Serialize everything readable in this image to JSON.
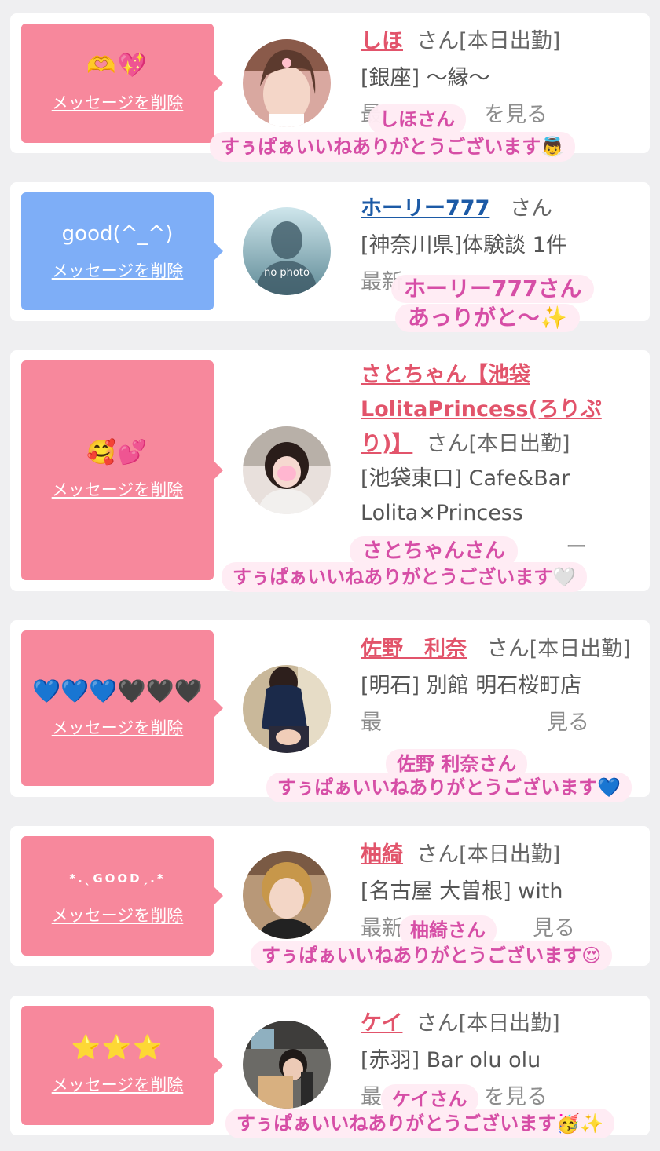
{
  "delete_label": "メッセージを削除",
  "entries": [
    {
      "message": "🫶💖",
      "name": "しほ",
      "san": "さん",
      "status": "[本日出勤]",
      "location": "[銀座] 〜縁〜",
      "caption_name": "しほさん",
      "caption_text": "すぅぱぁいいねありがとうございます👼"
    },
    {
      "message": "good(^_^)",
      "name": "ホーリー777",
      "san": "さん",
      "location": "[神奈川県]体験談 1件",
      "avatar_text": "no photo",
      "caption_line1": "ホーリー777さん",
      "caption_line2": "あっりがと〜✨"
    },
    {
      "message": "🥰💕",
      "name": "さとちゃん【池袋LolitaPrincess(ろりぷり)】",
      "san": "さん",
      "status": "[本日出勤]",
      "location": "[池袋東口] Cafe&Bar Lolita×Princess",
      "caption_name": "さとちゃんさん",
      "caption_text": "すぅぱぁいいねありがとうございます🤍"
    },
    {
      "message": "💙💙💙🖤🖤🖤",
      "name": "佐野　利奈",
      "san": "さん",
      "status": "[本日出勤]",
      "location": "[明石] 別館 明石桜町店",
      "caption_name": "佐野 利奈さん",
      "caption_text": "すぅぱぁいいねありがとうございます💙"
    },
    {
      "message": "*.ˎGOODˏ.*",
      "name": "柚綺",
      "san": "さん",
      "status": "[本日出勤]",
      "location": "[名古屋 大曽根] with",
      "caption_name": "柚綺さん",
      "caption_text": "すぅぱぁいいねありがとうございます😍"
    },
    {
      "message": "⭐⭐⭐",
      "name": "ケイ",
      "san": "さん",
      "status": "[本日出勤]",
      "location": "[赤羽] Bar olu olu",
      "caption_name": "ケイさん",
      "caption_text": "すぅぱぁいいねありがとうございます🥳✨"
    }
  ],
  "peek_texts": {
    "e0": "最",
    "e0r": "を見る",
    "e1": "最新",
    "e2": "ー",
    "e3": "最",
    "e3r": "見る",
    "e4": "最新",
    "e4r": "見る",
    "e5": "最",
    "e5r": "を見る"
  }
}
